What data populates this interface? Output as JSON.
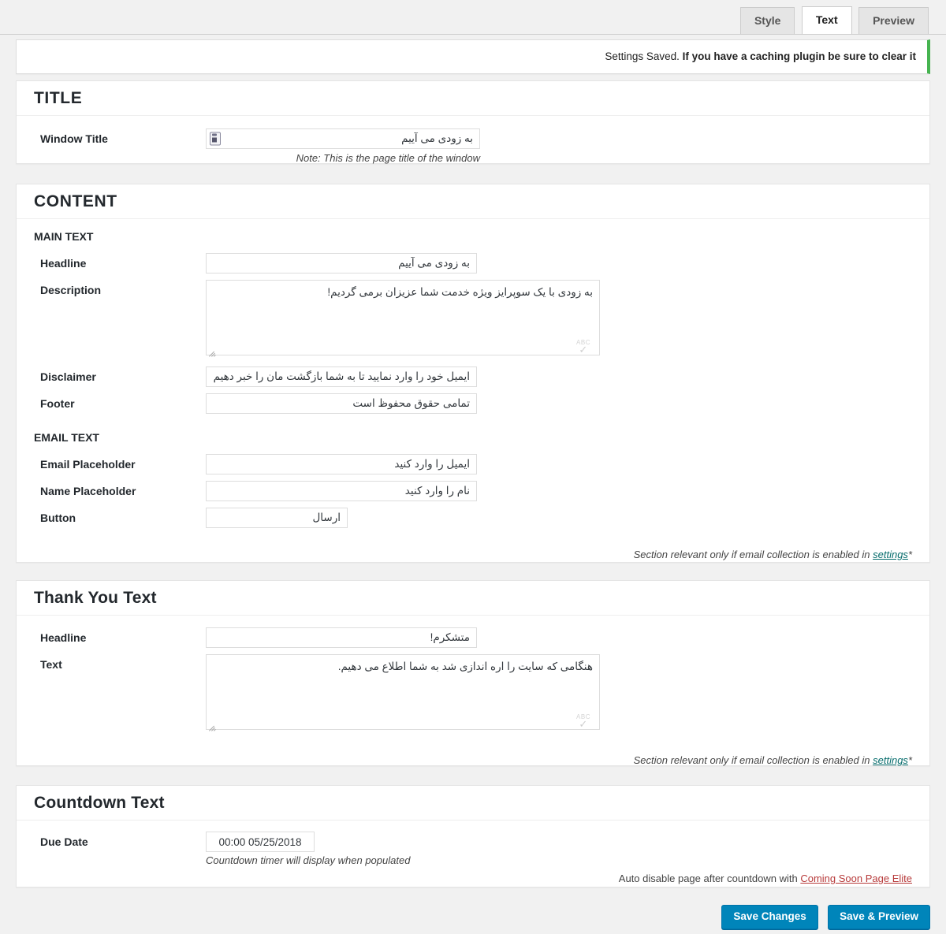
{
  "tabs": [
    {
      "label": "Preview",
      "active": false
    },
    {
      "label": "Text",
      "active": true
    },
    {
      "label": "Style",
      "active": false
    }
  ],
  "notice": {
    "saved_text": "Settings Saved.",
    "caching_text": "If you have a caching plugin be sure to clear it",
    "accent_color": "#46b450"
  },
  "title_panel": {
    "heading": "TITLE",
    "window_title": {
      "label": "Window Title",
      "value": "به زودی می آییم",
      "note": "Note: This is the page title of the window",
      "icon": "form-fill-icon"
    }
  },
  "content_panel": {
    "heading": "CONTENT",
    "main_text_subhead": "MAIN TEXT",
    "headline": {
      "label": "Headline",
      "value": "به زودی می آییم"
    },
    "description": {
      "label": "Description",
      "value": "به زودی با یک سوپرایز ویژه خدمت شما عزیزان برمی گردیم!"
    },
    "disclaimer": {
      "label": "Disclaimer",
      "value": "ایمیل خود را وارد نمایید تا به شما بازگشت مان را خبر دهیم"
    },
    "footer": {
      "label": "Footer",
      "value": "تمامی حقوق محفوظ است"
    },
    "email_text_subhead": "EMAIL TEXT",
    "email_placeholder": {
      "label": "Email Placeholder",
      "value": "ایمیل را وارد کنید"
    },
    "name_placeholder": {
      "label": "Name Placeholder",
      "value": "نام را وارد کنید"
    },
    "button": {
      "label": "Button",
      "value": "ارسال"
    },
    "footnote_prefix": "*",
    "footnote_text": "Section relevant only if email collection is enabled in ",
    "footnote_link": "settings"
  },
  "thankyou_panel": {
    "heading": "Thank You Text",
    "headline": {
      "label": "Headline",
      "value": "متشکرم!"
    },
    "text": {
      "label": "Text",
      "value": "هنگامی که سایت را اره اندازی شد به شما اطلاع می دهیم."
    },
    "footnote_prefix": "*",
    "footnote_text": "Section relevant only if email collection is enabled in ",
    "footnote_link": "settings"
  },
  "countdown_panel": {
    "heading": "Countdown Text",
    "due_date": {
      "label": "Due Date",
      "value": "00:00 05/25/2018"
    },
    "note": "Countdown timer will display when populated",
    "auto_disable_text": "Auto disable page after countdown with ",
    "auto_disable_link": "Coming Soon Page Elite"
  },
  "actions": {
    "save_preview_label": "Save & Preview",
    "save_changes_label": "Save Changes",
    "button_color": "#0085ba"
  },
  "spellcheck_mark": "ABC"
}
